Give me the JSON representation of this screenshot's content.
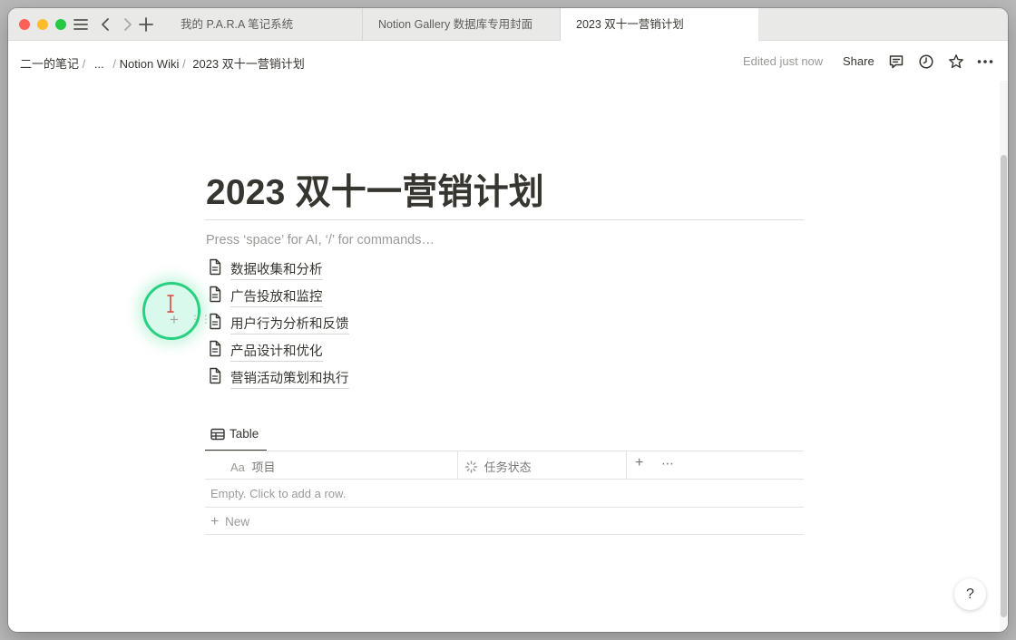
{
  "tabs": [
    {
      "label": "我的 P.A.R.A 笔记系统"
    },
    {
      "label": "Notion Gallery 数据库专用封面"
    },
    {
      "label": "2023 双十一营销计划"
    }
  ],
  "breadcrumb": {
    "workspace": "二一的笔记",
    "ellipsis": "...",
    "parent": "Notion Wiki",
    "current": "2023 双十一营销计划",
    "separator": "/"
  },
  "topbar": {
    "edited_label": "Edited just now",
    "share_label": "Share"
  },
  "page": {
    "title": "2023 双十一营销计划",
    "placeholder": "Press ‘space’ for AI, ‘/’ for commands…",
    "subpages": [
      {
        "label": "数据收集和分析"
      },
      {
        "label": "广告投放和监控"
      },
      {
        "label": "用户行为分析和反馈"
      },
      {
        "label": "产品设计和优化"
      },
      {
        "label": "营销活动策划和执行"
      }
    ]
  },
  "table": {
    "view_label": "Table",
    "columns": [
      {
        "prefix": "Aa",
        "label": "项目"
      },
      {
        "label": "任务状态"
      }
    ],
    "empty_text": "Empty. Click to add a row.",
    "new_label": "New"
  },
  "help_label": "?",
  "icons": {
    "sidebar": "hamburger-menu-icon",
    "back": "chevron-left-icon",
    "forward": "chevron-right-icon",
    "new_tab": "plus-icon",
    "comments": "comment-icon",
    "history": "clock-icon",
    "favorite": "star-icon",
    "more": "more-horizontal-icon",
    "subpage": "document-icon",
    "table_view": "table-icon",
    "status": "loading-status-icon"
  },
  "colors": {
    "accent_cursor": "#27d17f",
    "text": "#37352f",
    "muted": "#9b9a97"
  }
}
